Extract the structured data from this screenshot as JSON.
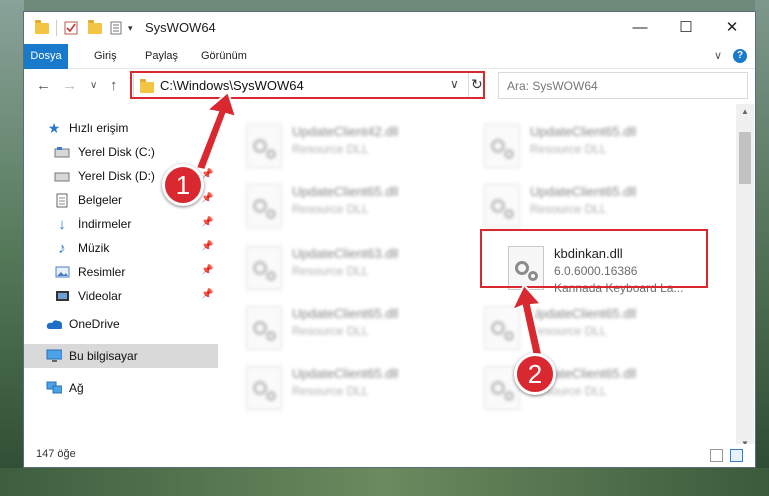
{
  "window": {
    "title": "SysWOW64"
  },
  "ribbon": {
    "tabs": [
      "Dosya",
      "Giriş",
      "Paylaş",
      "Görünüm"
    ]
  },
  "address": {
    "path": "C:\\Windows\\SysWOW64"
  },
  "search": {
    "placeholder": "Ara: SysWOW64"
  },
  "nav": {
    "items": [
      {
        "label": "Hızlı erişim",
        "icon": "star-icon"
      },
      {
        "label": "Yerel Disk (C:)",
        "icon": "drive-icon",
        "pinned": true
      },
      {
        "label": "Yerel Disk (D:)",
        "icon": "drive-icon",
        "pinned": true
      },
      {
        "label": "Belgeler",
        "icon": "document-icon",
        "pinned": true
      },
      {
        "label": "İndirmeler",
        "icon": "download-icon",
        "pinned": true
      },
      {
        "label": "Müzik",
        "icon": "music-icon",
        "pinned": true
      },
      {
        "label": "Resimler",
        "icon": "pictures-icon",
        "pinned": true
      },
      {
        "label": "Videolar",
        "icon": "video-icon",
        "pinned": true
      },
      {
        "label": "OneDrive",
        "icon": "cloud-icon"
      },
      {
        "label": "Bu bilgisayar",
        "icon": "computer-icon",
        "selected": true
      },
      {
        "label": "Ağ",
        "icon": "network-icon"
      }
    ]
  },
  "files": [
    {
      "name": "UpdateClient42.dll",
      "desc": "Resource DLL"
    },
    {
      "name": "UpdateClient65.dll",
      "desc": "Resource DLL"
    },
    {
      "name": "UpdateClient65.dll",
      "desc": "Resource DLL"
    },
    {
      "name": "UpdateClient65.dll",
      "desc": "Resource DLL"
    },
    {
      "name": "UpdateClient63.dll",
      "desc": "Resource DLL"
    },
    {
      "name": "kbdinkan.dll",
      "version": "6.0.6000.16386",
      "desc": "Kannada Keyboard La..."
    },
    {
      "name": "UpdateClient65.dll",
      "desc": "Resource DLL"
    },
    {
      "name": "UpdateClient65.dll",
      "desc": "Resource DLL"
    },
    {
      "name": "UpdateClient65.dll",
      "desc": "Resource DLL"
    },
    {
      "name": "UpdateClient65.dll",
      "desc": "Resource DLL"
    }
  ],
  "status": {
    "count": "147 öğe"
  },
  "callouts": {
    "one": "1",
    "two": "2"
  },
  "colors": {
    "accent": "#1979ca",
    "highlight": "#d9282f",
    "folder": "#f4c542"
  }
}
